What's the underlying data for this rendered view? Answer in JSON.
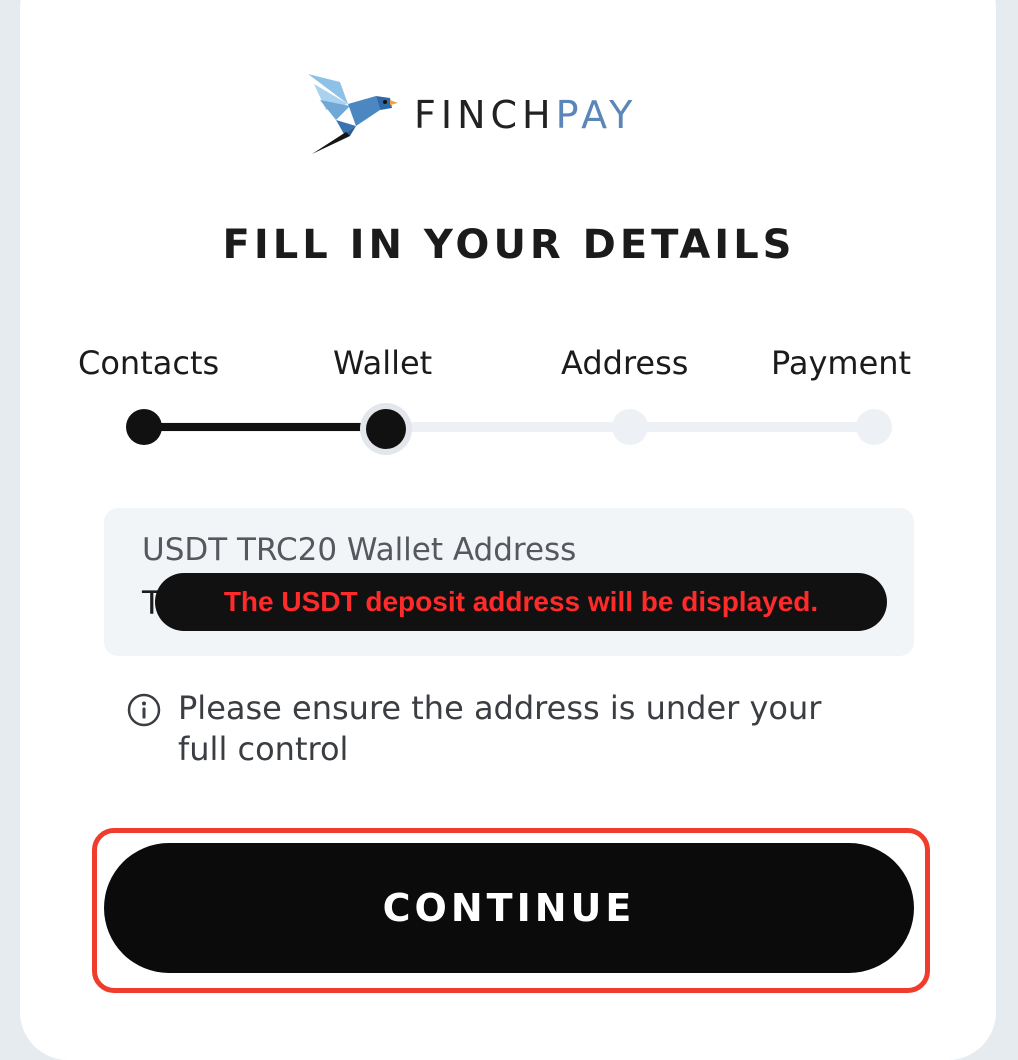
{
  "brand": {
    "name_part1": "FINCH",
    "name_part2": "PAY",
    "color_dark": "#222222",
    "color_accent": "#5b86b8",
    "logo_icon": "finch-bird-icon"
  },
  "page_title": "FILL IN YOUR DETAILS",
  "stepper": {
    "current_step": 2,
    "steps": [
      {
        "label": "Contacts",
        "state": "done"
      },
      {
        "label": "Wallet",
        "state": "current"
      },
      {
        "label": "Address",
        "state": "todo"
      },
      {
        "label": "Payment",
        "state": "todo"
      }
    ]
  },
  "wallet_field": {
    "label": "USDT TRC20 Wallet Address",
    "value": "T"
  },
  "annotation_note": "The USDT deposit address will be displayed.",
  "info": {
    "icon": "info-icon",
    "text": "Please ensure the address is under your full control"
  },
  "continue_button": {
    "label": "CONTINUE",
    "highlight_color": "#f03c2c"
  }
}
